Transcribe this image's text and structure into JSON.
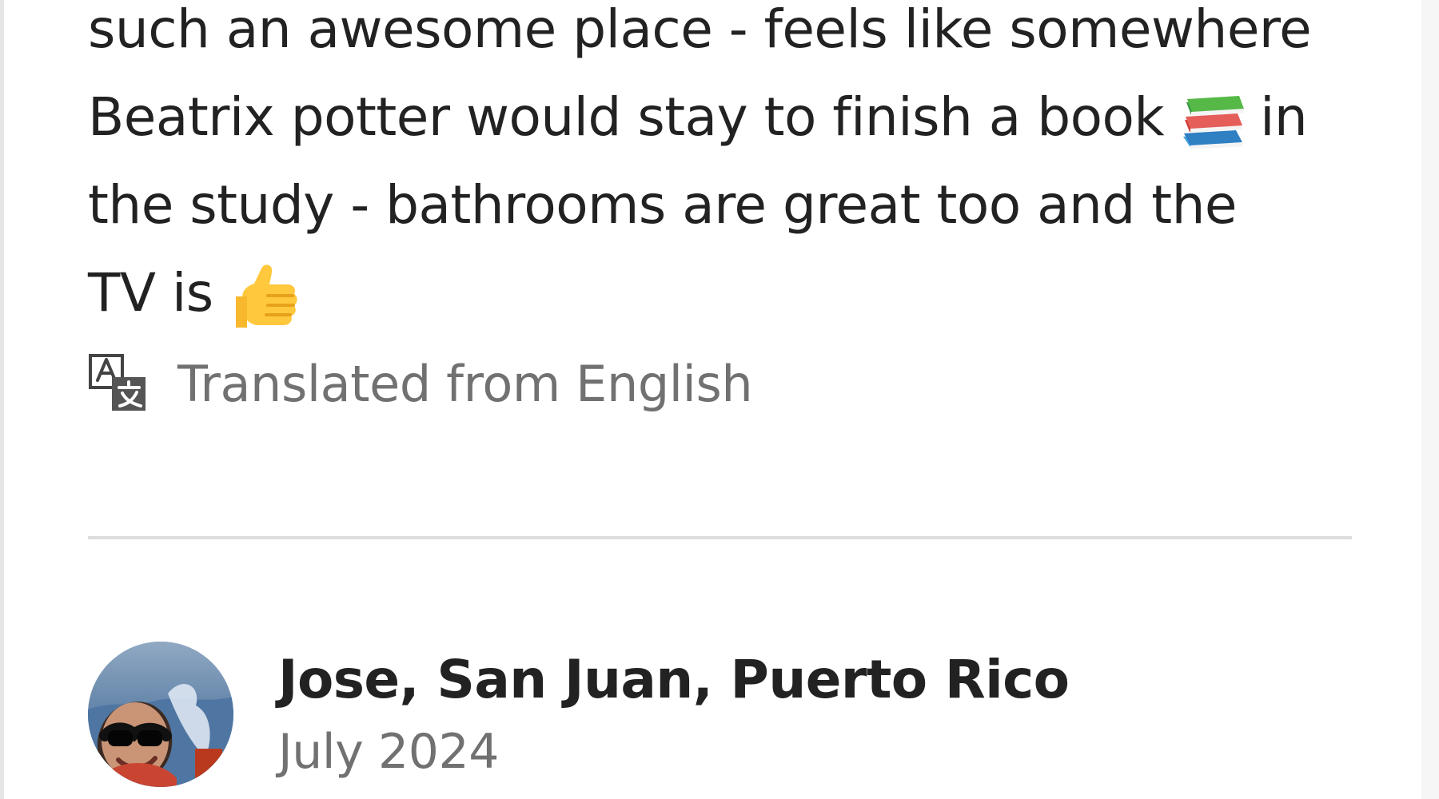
{
  "review": {
    "lines": [
      "such an awesome place - feels like somewhere",
      "Beatrix potter would stay to finish a book",
      "in",
      "the study - bathrooms are great too and the",
      "TV is"
    ],
    "emojis": {
      "books": "books-emoji",
      "thumbs_up": "thumbs-up-emoji"
    }
  },
  "translation": {
    "icon": "translate-icon",
    "label": "Translated from English"
  },
  "reviewer": {
    "name": "Jose, San Juan, Puerto Rico",
    "date": "July 2024",
    "avatar": "reviewer-avatar"
  }
}
